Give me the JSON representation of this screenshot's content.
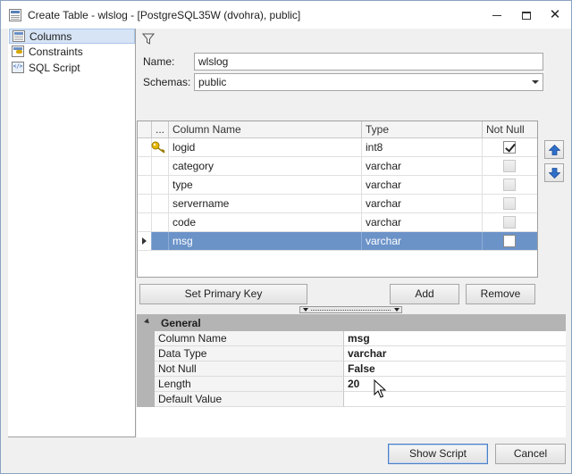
{
  "window": {
    "title": "Create Table - wlslog - [PostgreSQL35W (dvohra), public]"
  },
  "sidebar": {
    "items": [
      {
        "label": "Columns",
        "icon": "table-icon",
        "selected": true
      },
      {
        "label": "Constraints",
        "icon": "constraint-key-icon",
        "selected": false
      },
      {
        "label": "SQL Script",
        "icon": "script-icon",
        "selected": false
      }
    ]
  },
  "form": {
    "name_label": "Name:",
    "name_value": "wlslog",
    "schemas_label": "Schemas:",
    "schemas_value": "public"
  },
  "columns_grid": {
    "headers": {
      "indicator": "...",
      "name": "Column Name",
      "type": "Type",
      "not_null": "Not Null"
    },
    "rows": [
      {
        "name": "logid",
        "type": "int8",
        "not_null": true,
        "primary_key": true,
        "selected": false
      },
      {
        "name": "category",
        "type": "varchar",
        "not_null": false,
        "primary_key": false,
        "selected": false
      },
      {
        "name": "type",
        "type": "varchar",
        "not_null": false,
        "primary_key": false,
        "selected": false
      },
      {
        "name": "servername",
        "type": "varchar",
        "not_null": false,
        "primary_key": false,
        "selected": false
      },
      {
        "name": "code",
        "type": "varchar",
        "not_null": false,
        "primary_key": false,
        "selected": false
      },
      {
        "name": "msg",
        "type": "varchar",
        "not_null": false,
        "primary_key": false,
        "selected": true
      }
    ]
  },
  "buttons": {
    "set_primary_key": "Set Primary Key",
    "add": "Add",
    "remove": "Remove",
    "show_script": "Show Script",
    "cancel": "Cancel"
  },
  "properties": {
    "group_label": "General",
    "rows": [
      {
        "name": "Column Name",
        "value": "msg"
      },
      {
        "name": "Data Type",
        "value": "varchar"
      },
      {
        "name": "Not Null",
        "value": "False"
      },
      {
        "name": "Length",
        "value": "20"
      },
      {
        "name": "Default Value",
        "value": ""
      }
    ]
  }
}
